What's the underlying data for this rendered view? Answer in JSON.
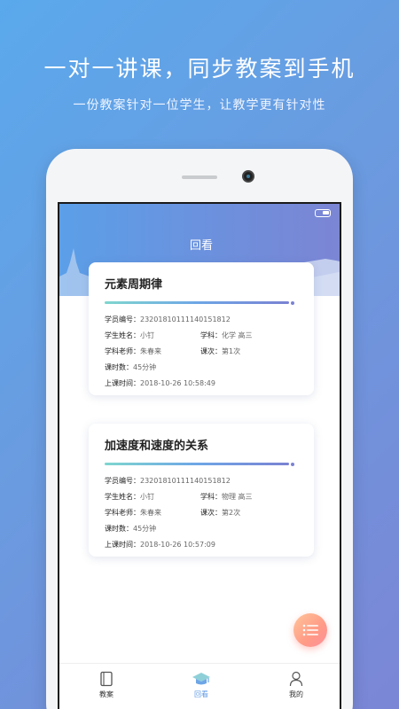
{
  "promo": {
    "title": "一对一讲课，同步教案到手机",
    "subtitle": "一份教案针对一位学生，让教学更有针对性"
  },
  "screen": {
    "page_title": "回看"
  },
  "labels": {
    "student_id": "学员编号：",
    "student_name": "学生姓名：",
    "subject": "学科：",
    "teacher": "学科老师：",
    "session": "课次：",
    "duration": "课时数：",
    "class_time": "上课时间："
  },
  "cards": [
    {
      "title": "元素周期律",
      "progress": 1.0,
      "student_id": "23201810111140151812",
      "student_name": "小钉",
      "subject": "化学 高三",
      "teacher": "朱春来",
      "session": "第1次",
      "duration": "45分钟",
      "class_time": "2018-10-26 10:58:49"
    },
    {
      "title": "加速度和速度的关系",
      "progress": 1.0,
      "student_id": "23201810111140151812",
      "student_name": "小钉",
      "subject": "物理 高三",
      "teacher": "朱春来",
      "session": "第2次",
      "duration": "45分钟",
      "class_time": "2018-10-26 10:57:09"
    }
  ],
  "tabs": [
    {
      "label": "教案",
      "icon": "book-icon"
    },
    {
      "label": "回看",
      "icon": "graduation-cap-icon",
      "active": true
    },
    {
      "label": "我的",
      "icon": "user-icon"
    }
  ],
  "colors": {
    "accent": "#5e98e4",
    "fab": "#ff9a86"
  }
}
